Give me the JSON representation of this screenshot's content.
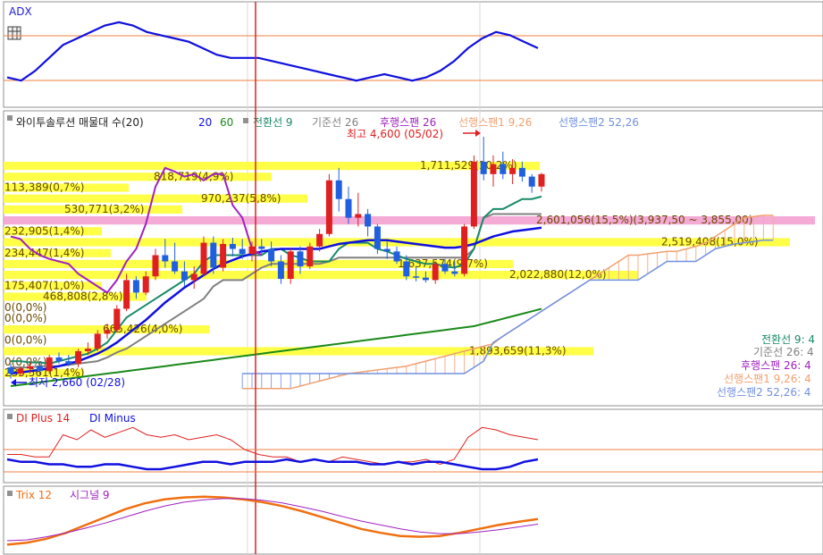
{
  "panels": {
    "adx": {
      "title": "ADX"
    },
    "main": {
      "title": "와이투솔루션 매물대 수(20)",
      "legend": [
        {
          "label": "20",
          "color": "#1010e0"
        },
        {
          "label": "60",
          "color": "#1a8a1a"
        },
        {
          "label": "전환선 9",
          "color": "#1a8a6a"
        },
        {
          "label": "기준선 26",
          "color": "#808080"
        },
        {
          "label": "후행스팬 26",
          "color": "#a020c0"
        },
        {
          "label": "선행스팬1 9,26",
          "color": "#f0a070"
        },
        {
          "label": "선행스팬2 52,26",
          "color": "#7090e0"
        }
      ],
      "high_label": "최고 4,600 (05/02)",
      "low_label": "최저 2,660 (02/28)",
      "right_labels": [
        "전환선 9: 4",
        "기준선 26: 4",
        "후행스팬 26: 4",
        "선행스팬1 9,26: 4",
        "선행스팬2 52,26: 4"
      ]
    },
    "di": {
      "title_plus": "DI Plus 14",
      "title_minus": "DI Minus"
    },
    "trix": {
      "title": "Trix 12",
      "signal": "시그널 9"
    }
  },
  "colors": {
    "up_candle": "#e02020",
    "down_candle": "#2060e0",
    "volume_bar": "#ffff33",
    "volume_bar_max": "#f4a0d0",
    "cursor_line": "#e02020",
    "ref_line": "#f08040"
  },
  "chart_data": {
    "type": "candlestick",
    "volume_profile": [
      {
        "label": "1,711,529(10,2%)"
      },
      {
        "label": "818,719(4,9%)"
      },
      {
        "label": "113,389(0,7%)"
      },
      {
        "label": "970,237(5,8%)"
      },
      {
        "label": "530,771(3,2%)"
      },
      {
        "label": "2,601,056(15,5%)(3,937,50 ~ 3,855,00)",
        "max": true
      },
      {
        "label": "232,905(1,4%)"
      },
      {
        "label": "2,519,408(15,0%)"
      },
      {
        "label": "234,447(1,4%)"
      },
      {
        "label": "1,637,574(9,7%)"
      },
      {
        "label": "2,022,880(12,0%)"
      },
      {
        "label": "175,407(1,0%)"
      },
      {
        "label": "468,808(2,8%)"
      },
      {
        "label": "0(0,0%)"
      },
      {
        "label": "0(0,0%)"
      },
      {
        "label": "665,426(4,0%)"
      },
      {
        "label": "0(0,0%)"
      },
      {
        "label": "1,893,659(11,3%)"
      },
      {
        "label": "0(0,0%)"
      },
      {
        "label": "235,561(1,4%)"
      }
    ],
    "candles": [
      {
        "o": 2750,
        "h": 2780,
        "l": 2660,
        "c": 2700
      },
      {
        "o": 2700,
        "h": 2760,
        "l": 2680,
        "c": 2740
      },
      {
        "o": 2740,
        "h": 2800,
        "l": 2700,
        "c": 2760
      },
      {
        "o": 2760,
        "h": 2790,
        "l": 2690,
        "c": 2720
      },
      {
        "o": 2720,
        "h": 2850,
        "l": 2700,
        "c": 2830
      },
      {
        "o": 2830,
        "h": 2870,
        "l": 2780,
        "c": 2800
      },
      {
        "o": 2800,
        "h": 2850,
        "l": 2760,
        "c": 2780
      },
      {
        "o": 2780,
        "h": 2900,
        "l": 2750,
        "c": 2880
      },
      {
        "o": 2880,
        "h": 2950,
        "l": 2850,
        "c": 2900
      },
      {
        "o": 2900,
        "h": 3050,
        "l": 2880,
        "c": 3020
      },
      {
        "o": 3020,
        "h": 3100,
        "l": 2980,
        "c": 3050
      },
      {
        "o": 3050,
        "h": 3250,
        "l": 3030,
        "c": 3220
      },
      {
        "o": 3220,
        "h": 3500,
        "l": 3200,
        "c": 3450
      },
      {
        "o": 3450,
        "h": 3480,
        "l": 3300,
        "c": 3350
      },
      {
        "o": 3350,
        "h": 3520,
        "l": 3330,
        "c": 3480
      },
      {
        "o": 3480,
        "h": 3700,
        "l": 3450,
        "c": 3650
      },
      {
        "o": 3650,
        "h": 3780,
        "l": 3550,
        "c": 3600
      },
      {
        "o": 3600,
        "h": 3750,
        "l": 3500,
        "c": 3520
      },
      {
        "o": 3520,
        "h": 3600,
        "l": 3400,
        "c": 3450
      },
      {
        "o": 3450,
        "h": 3560,
        "l": 3380,
        "c": 3500
      },
      {
        "o": 3500,
        "h": 3800,
        "l": 3480,
        "c": 3750
      },
      {
        "o": 3750,
        "h": 3800,
        "l": 3500,
        "c": 3550
      },
      {
        "o": 3550,
        "h": 3780,
        "l": 3520,
        "c": 3740
      },
      {
        "o": 3740,
        "h": 3790,
        "l": 3640,
        "c": 3700
      },
      {
        "o": 3700,
        "h": 3780,
        "l": 3620,
        "c": 3660
      },
      {
        "o": 3660,
        "h": 3760,
        "l": 3600,
        "c": 3720
      },
      {
        "o": 3720,
        "h": 3780,
        "l": 3660,
        "c": 3700
      },
      {
        "o": 3700,
        "h": 3760,
        "l": 3560,
        "c": 3600
      },
      {
        "o": 3600,
        "h": 3650,
        "l": 3420,
        "c": 3460
      },
      {
        "o": 3460,
        "h": 3700,
        "l": 3420,
        "c": 3680
      },
      {
        "o": 3680,
        "h": 3720,
        "l": 3500,
        "c": 3560
      },
      {
        "o": 3560,
        "h": 3750,
        "l": 3540,
        "c": 3720
      },
      {
        "o": 3720,
        "h": 3860,
        "l": 3680,
        "c": 3820
      },
      {
        "o": 3820,
        "h": 4300,
        "l": 3800,
        "c": 4250
      },
      {
        "o": 4250,
        "h": 4350,
        "l": 4000,
        "c": 4100
      },
      {
        "o": 4100,
        "h": 4200,
        "l": 3900,
        "c": 3950
      },
      {
        "o": 3950,
        "h": 4150,
        "l": 3880,
        "c": 3980
      },
      {
        "o": 3980,
        "h": 4020,
        "l": 3800,
        "c": 3880
      },
      {
        "o": 3880,
        "h": 3900,
        "l": 3660,
        "c": 3700
      },
      {
        "o": 3700,
        "h": 3760,
        "l": 3620,
        "c": 3680
      },
      {
        "o": 3680,
        "h": 3720,
        "l": 3580,
        "c": 3600
      },
      {
        "o": 3600,
        "h": 3650,
        "l": 3450,
        "c": 3480
      },
      {
        "o": 3480,
        "h": 3560,
        "l": 3440,
        "c": 3470
      },
      {
        "o": 3470,
        "h": 3520,
        "l": 3430,
        "c": 3450
      },
      {
        "o": 3450,
        "h": 3600,
        "l": 3420,
        "c": 3580
      },
      {
        "o": 3580,
        "h": 3620,
        "l": 3500,
        "c": 3520
      },
      {
        "o": 3520,
        "h": 3600,
        "l": 3480,
        "c": 3500
      },
      {
        "o": 3500,
        "h": 3900,
        "l": 3480,
        "c": 3880
      },
      {
        "o": 3880,
        "h": 4450,
        "l": 3860,
        "c": 4400
      },
      {
        "o": 4400,
        "h": 4600,
        "l": 4250,
        "c": 4300
      },
      {
        "o": 4300,
        "h": 4450,
        "l": 4200,
        "c": 4380
      },
      {
        "o": 4380,
        "h": 4480,
        "l": 4260,
        "c": 4300
      },
      {
        "o": 4300,
        "h": 4420,
        "l": 4220,
        "c": 4350
      },
      {
        "o": 4350,
        "h": 4400,
        "l": 4240,
        "c": 4280
      },
      {
        "o": 4280,
        "h": 4300,
        "l": 4150,
        "c": 4200
      },
      {
        "o": 4200,
        "h": 4310,
        "l": 4160,
        "c": 4300
      }
    ],
    "ma20": [
      2700,
      2710,
      2720,
      2730,
      2745,
      2760,
      2780,
      2800,
      2830,
      2860,
      2900,
      2950,
      3010,
      3070,
      3130,
      3200,
      3270,
      3330,
      3390,
      3440,
      3490,
      3540,
      3580,
      3610,
      3640,
      3660,
      3680,
      3690,
      3700,
      3700,
      3700,
      3700,
      3700,
      3720,
      3740,
      3750,
      3760,
      3770,
      3770,
      3770,
      3760,
      3750,
      3740,
      3730,
      3720,
      3710,
      3710,
      3720,
      3740,
      3770,
      3800,
      3820,
      3840,
      3850,
      3860,
      3870
    ],
    "ma60": [
      2600,
      2610,
      2620,
      2630,
      2640,
      2650,
      2660,
      2670,
      2680,
      2690,
      2700,
      2710,
      2720,
      2730,
      2740,
      2750,
      2760,
      2770,
      2780,
      2790,
      2800,
      2810,
      2820,
      2830,
      2840,
      2850,
      2860,
      2870,
      2880,
      2890,
      2900,
      2910,
      2920,
      2930,
      2940,
      2950,
      2960,
      2970,
      2980,
      2990,
      3000,
      3010,
      3020,
      3030,
      3040,
      3050,
      3060,
      3070,
      3080,
      3100,
      3120,
      3140,
      3160,
      3180,
      3200,
      3220
    ],
    "conversion9": [
      2800,
      2800,
      2790,
      2790,
      2780,
      2800,
      2820,
      2840,
      2860,
      2900,
      2950,
      3050,
      3150,
      3200,
      3250,
      3300,
      3350,
      3400,
      3450,
      3500,
      3600,
      3650,
      3650,
      3650,
      3650,
      3650,
      3650,
      3700,
      3700,
      3650,
      3630,
      3600,
      3600,
      3600,
      3700,
      3750,
      3750,
      3750,
      3700,
      3680,
      3650,
      3620,
      3600,
      3580,
      3580,
      3560,
      3550,
      3580,
      3700,
      3950,
      4020,
      4020,
      4060,
      4100,
      4100,
      4120
    ],
    "base26": [
      2750,
      2750,
      2750,
      2760,
      2760,
      2760,
      2770,
      2780,
      2790,
      2800,
      2830,
      2870,
      2900,
      2950,
      3000,
      3050,
      3100,
      3150,
      3200,
      3250,
      3300,
      3400,
      3450,
      3450,
      3450,
      3500,
      3550,
      3580,
      3580,
      3580,
      3580,
      3580,
      3580,
      3600,
      3630,
      3630,
      3630,
      3630,
      3630,
      3630,
      3630,
      3630,
      3630,
      3630,
      3630,
      3630,
      3630,
      3630,
      3700,
      3950,
      3980,
      3980,
      3980,
      3980,
      3980,
      3980
    ],
    "lagging26": [
      3800,
      3780,
      3700,
      3650,
      3620,
      3600,
      3580,
      3500,
      3450,
      3400,
      3350,
      3450,
      3600,
      3700,
      3900,
      4200,
      4350,
      4320,
      4280,
      4300,
      4250,
      4300,
      4300,
      4050,
      3950,
      3700,
      3650
    ],
    "span1": [
      2580,
      2580,
      2580,
      2580,
      2580,
      2580,
      2600,
      2620,
      2640,
      2660,
      2680,
      2700,
      2710,
      2720,
      2730,
      2740,
      2750,
      2760,
      2780,
      2800,
      2820,
      2840,
      2860,
      2880,
      2900,
      2920,
      2940,
      3000,
      3050,
      3100,
      3150,
      3200,
      3250,
      3300,
      3350,
      3400,
      3450,
      3500,
      3550,
      3600,
      3650,
      3650,
      3660,
      3670,
      3680,
      3680,
      3700,
      3720,
      3750,
      3800,
      3850,
      3900,
      3950,
      3960,
      3970,
      3970
    ],
    "span2": [
      2700,
      2700,
      2700,
      2700,
      2700,
      2700,
      2700,
      2700,
      2700,
      2700,
      2700,
      2700,
      2700,
      2700,
      2700,
      2700,
      2700,
      2700,
      2700,
      2700,
      2700,
      2700,
      2700,
      2700,
      2750,
      2800,
      2950,
      3000,
      3050,
      3100,
      3150,
      3200,
      3250,
      3300,
      3350,
      3400,
      3450,
      3450,
      3450,
      3450,
      3450,
      3450,
      3500,
      3550,
      3600,
      3600,
      3600,
      3600,
      3650,
      3700,
      3720,
      3740,
      3750,
      3760,
      3770,
      3770
    ],
    "adx": [
      22,
      21,
      24,
      28,
      32,
      34,
      36,
      38,
      39,
      38,
      36,
      35,
      34,
      33,
      31,
      29,
      28,
      28,
      28,
      27,
      26,
      25,
      24,
      23,
      22,
      21,
      22,
      23,
      22,
      21,
      22,
      24,
      27,
      31,
      34,
      36,
      35,
      33,
      31
    ],
    "di_plus": [
      18,
      18,
      17,
      17,
      26,
      24,
      28,
      25,
      27,
      29,
      26,
      25,
      26,
      24,
      25,
      26,
      24,
      20,
      18,
      17,
      17,
      15,
      16,
      15,
      17,
      16,
      15,
      14,
      15,
      15,
      16,
      14,
      16,
      25,
      29,
      28,
      26,
      25,
      24
    ],
    "di_minus": [
      16,
      15,
      15,
      14,
      14,
      13,
      13,
      14,
      14,
      13,
      12,
      12,
      13,
      14,
      15,
      15,
      14,
      15,
      15,
      15,
      16,
      15,
      16,
      15,
      15,
      15,
      14,
      14,
      15,
      14,
      15,
      15,
      14,
      13,
      12,
      12,
      13,
      15,
      16
    ],
    "trix": [
      -0.6,
      -0.55,
      -0.45,
      -0.3,
      -0.1,
      0.1,
      0.3,
      0.45,
      0.55,
      0.6,
      0.62,
      0.6,
      0.55,
      0.48,
      0.38,
      0.25,
      0.1,
      -0.05,
      -0.2,
      -0.3,
      -0.38,
      -0.4,
      -0.38,
      -0.3,
      -0.2,
      -0.1,
      -0.02,
      0.05
    ],
    "trix_signal": [
      -0.5,
      -0.48,
      -0.4,
      -0.3,
      -0.18,
      -0.05,
      0.1,
      0.25,
      0.38,
      0.48,
      0.54,
      0.57,
      0.57,
      0.53,
      0.46,
      0.36,
      0.25,
      0.12,
      0.0,
      -0.1,
      -0.2,
      -0.28,
      -0.32,
      -0.32,
      -0.28,
      -0.22,
      -0.15,
      -0.08
    ]
  }
}
